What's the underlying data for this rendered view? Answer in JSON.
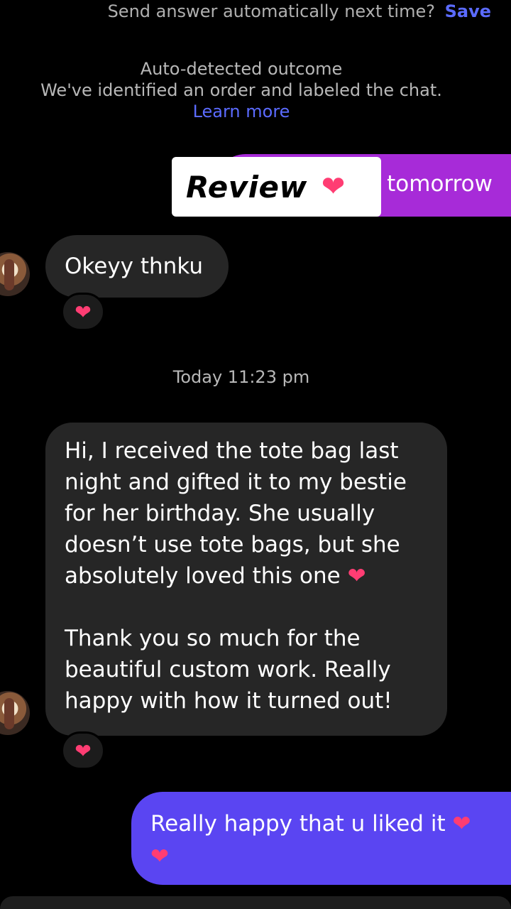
{
  "banner": {
    "prompt_text": "Send answer automatically next time?",
    "save_label": "Save"
  },
  "auto_outcome": {
    "title": "Auto-detected outcome",
    "description": "We've identified an order and labeled the chat.",
    "learn_more_label": "Learn more"
  },
  "overlay": {
    "label": "Review",
    "icon": "heart-icon"
  },
  "messages": [
    {
      "direction": "sent",
      "text": "tomorrow",
      "color": "#a72bd8"
    },
    {
      "direction": "received",
      "text": "Okeyy thnku",
      "reaction": "❤️"
    },
    {
      "direction": "received",
      "paragraphs": [
        "Hi, I received the tote bag last night and gifted it to my bestie for her birthday. She usually doesn’t use tote bags, but she absolutely loved this one",
        "Thank you so much for the beautiful custom work. Really happy with how it turned out!"
      ],
      "reaction": "❤️"
    },
    {
      "direction": "sent",
      "text": "Really happy that u liked it",
      "color": "#5a45f2"
    }
  ],
  "timestamp": "Today 11:23 pm",
  "colors": {
    "accent_link": "#5b6bff",
    "heart": "#ff3d73",
    "received_bubble": "#262626"
  }
}
